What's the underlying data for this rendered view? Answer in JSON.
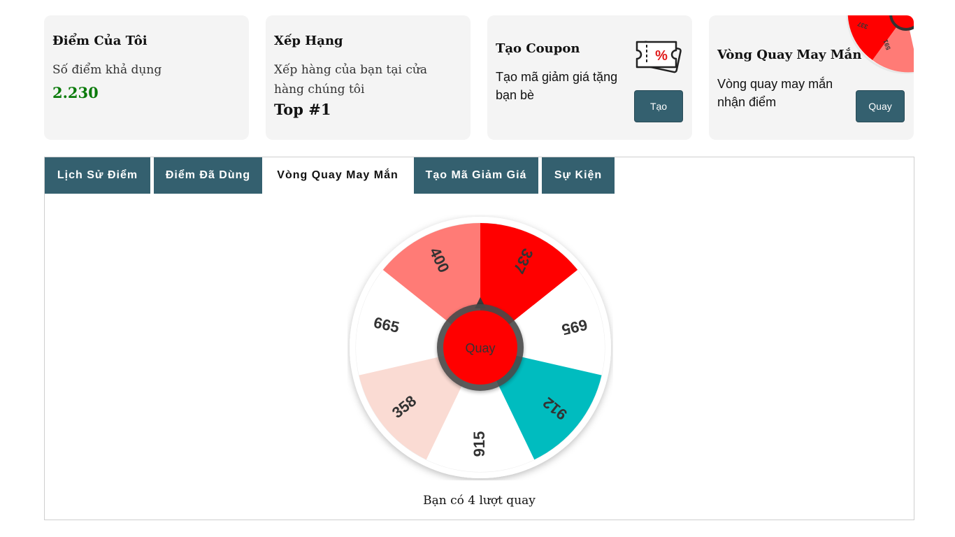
{
  "cards": {
    "points": {
      "title": "Điểm Của Tôi",
      "label": "Số điểm khả dụng",
      "value": "2.230",
      "value_color": "#0a7a0a"
    },
    "ranking": {
      "title": "Xếp Hạng",
      "label": "Xếp hàng của bạn tại cửa hàng chúng tôi",
      "value": "Top #1"
    },
    "coupon": {
      "title": "Tạo Coupon",
      "label": "Tạo mã giảm giá tặng bạn bè",
      "button": "Tạo",
      "icon": "coupon-ticket-icon"
    },
    "lucky": {
      "title": "Vòng Quay May Mắn",
      "label": "Vòng quay may mắn nhận điểm",
      "button": "Quay",
      "mini_labels": [
        "337",
        "591"
      ]
    }
  },
  "tabs": [
    {
      "label": "Lịch Sử Điểm",
      "active": false
    },
    {
      "label": "Điểm Đã Dùng",
      "active": false
    },
    {
      "label": "Vòng Quay May Mắn",
      "active": true
    },
    {
      "label": "Tạo Mã Giảm Giá",
      "active": false
    },
    {
      "label": "Sự Kiện",
      "active": false
    }
  ],
  "wheel": {
    "center_button": "Quay",
    "segments": [
      {
        "label": "337",
        "color": "#ff0000"
      },
      {
        "label": "695",
        "color": "#ffffff"
      },
      {
        "label": "912",
        "color": "#00bcbf"
      },
      {
        "label": "915",
        "color": "#ffffff"
      },
      {
        "label": "358",
        "color": "#fadbd3"
      },
      {
        "label": "665",
        "color": "#ffffff"
      },
      {
        "label": "400",
        "color": "#ff7b76"
      }
    ]
  },
  "spin_count_text": "Bạn có 4 lượt quay",
  "colors": {
    "primary": "#34606f",
    "wheel_center": "#ff0000",
    "card_bg": "#f4f4f4"
  }
}
